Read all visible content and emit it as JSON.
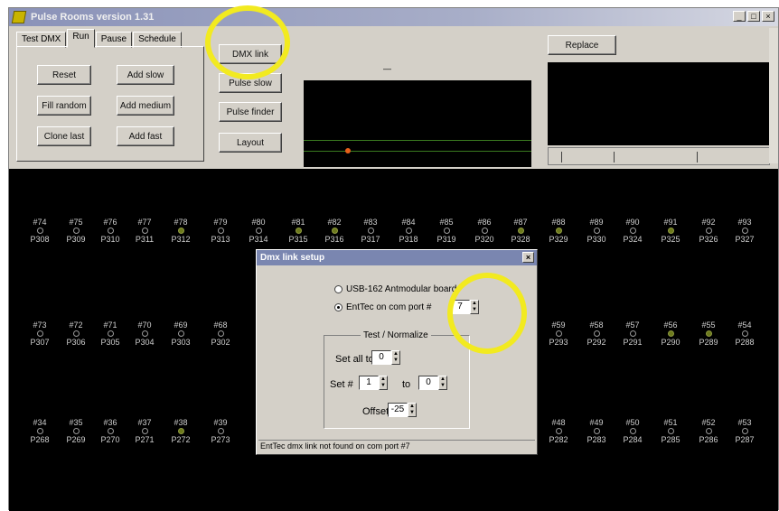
{
  "window": {
    "title": "Pulse Rooms version 1.31",
    "minimize": "_",
    "maximize": "□",
    "close": "×"
  },
  "tabs": [
    "Test DMX",
    "Run",
    "Pause",
    "Schedule"
  ],
  "run_buttons": [
    "Reset",
    "Add slow",
    "Fill random",
    "Add medium",
    "Clone last",
    "Add fast"
  ],
  "side_buttons": [
    "DMX link",
    "Pulse slow",
    "Pulse finder",
    "Layout"
  ],
  "replace_label": "Replace",
  "scope_label": "—",
  "rows": [
    [
      {
        "n": "#74",
        "p": "P308",
        "on": false
      },
      {
        "n": "#75",
        "p": "P309",
        "on": false
      },
      {
        "n": "#76",
        "p": "P310",
        "on": false
      },
      {
        "n": "#77",
        "p": "P311",
        "on": false
      },
      {
        "n": "#78",
        "p": "P312",
        "on": true
      },
      {
        "n": "#79",
        "p": "P313",
        "on": false
      },
      {
        "n": "#80",
        "p": "P314",
        "on": false
      },
      {
        "n": "#81",
        "p": "P315",
        "on": true
      },
      {
        "n": "#82",
        "p": "P316",
        "on": true
      },
      {
        "n": "#83",
        "p": "P317",
        "on": false
      },
      {
        "n": "#84",
        "p": "P318",
        "on": false
      },
      {
        "n": "#85",
        "p": "P319",
        "on": false
      },
      {
        "n": "#86",
        "p": "P320",
        "on": false
      },
      {
        "n": "#87",
        "p": "P328",
        "on": true
      },
      {
        "n": "#88",
        "p": "P329",
        "on": true
      },
      {
        "n": "#89",
        "p": "P330",
        "on": false
      },
      {
        "n": "#90",
        "p": "P324",
        "on": false
      },
      {
        "n": "#91",
        "p": "P325",
        "on": true
      },
      {
        "n": "#92",
        "p": "P326",
        "on": false
      },
      {
        "n": "#93",
        "p": "P327",
        "on": false
      }
    ],
    [
      {
        "n": "#73",
        "p": "P307",
        "on": false
      },
      {
        "n": "#72",
        "p": "P306",
        "on": false
      },
      {
        "n": "#71",
        "p": "P305",
        "on": false
      },
      {
        "n": "#70",
        "p": "P304",
        "on": false
      },
      {
        "n": "#69",
        "p": "P303",
        "on": false
      },
      {
        "n": "#68",
        "p": "P302",
        "on": false
      },
      {
        "n": "#59",
        "p": "P293",
        "on": false
      },
      {
        "n": "#58",
        "p": "P292",
        "on": false
      },
      {
        "n": "#57",
        "p": "P291",
        "on": false
      },
      {
        "n": "#56",
        "p": "P290",
        "on": true
      },
      {
        "n": "#55",
        "p": "P289",
        "on": true
      },
      {
        "n": "#54",
        "p": "P288",
        "on": false
      }
    ],
    [
      {
        "n": "#34",
        "p": "P268",
        "on": false
      },
      {
        "n": "#35",
        "p": "P269",
        "on": false
      },
      {
        "n": "#36",
        "p": "P270",
        "on": false
      },
      {
        "n": "#37",
        "p": "P271",
        "on": false
      },
      {
        "n": "#38",
        "p": "P272",
        "on": true
      },
      {
        "n": "#39",
        "p": "P273",
        "on": false
      },
      {
        "n": "#48",
        "p": "P282",
        "on": false
      },
      {
        "n": "#49",
        "p": "P283",
        "on": false
      },
      {
        "n": "#50",
        "p": "P284",
        "on": false
      },
      {
        "n": "#51",
        "p": "P285",
        "on": false
      },
      {
        "n": "#52",
        "p": "P286",
        "on": false
      },
      {
        "n": "#53",
        "p": "P287",
        "on": false
      }
    ]
  ],
  "dialog": {
    "title": "Dmx link setup",
    "close": "×",
    "option1": "USB-162 Antmodular board",
    "option2": "EntTec on com port #",
    "port": "7",
    "group_title": "Test / Normalize",
    "set_all_label": "Set all to",
    "set_all_value": "0",
    "set_num_label": "Set #",
    "set_num_value": "1",
    "to_label": "to",
    "to_value": "0",
    "offset_label": "Offset",
    "offset_value": "-25",
    "status": "EntTec dmx link not found on com port #7"
  }
}
